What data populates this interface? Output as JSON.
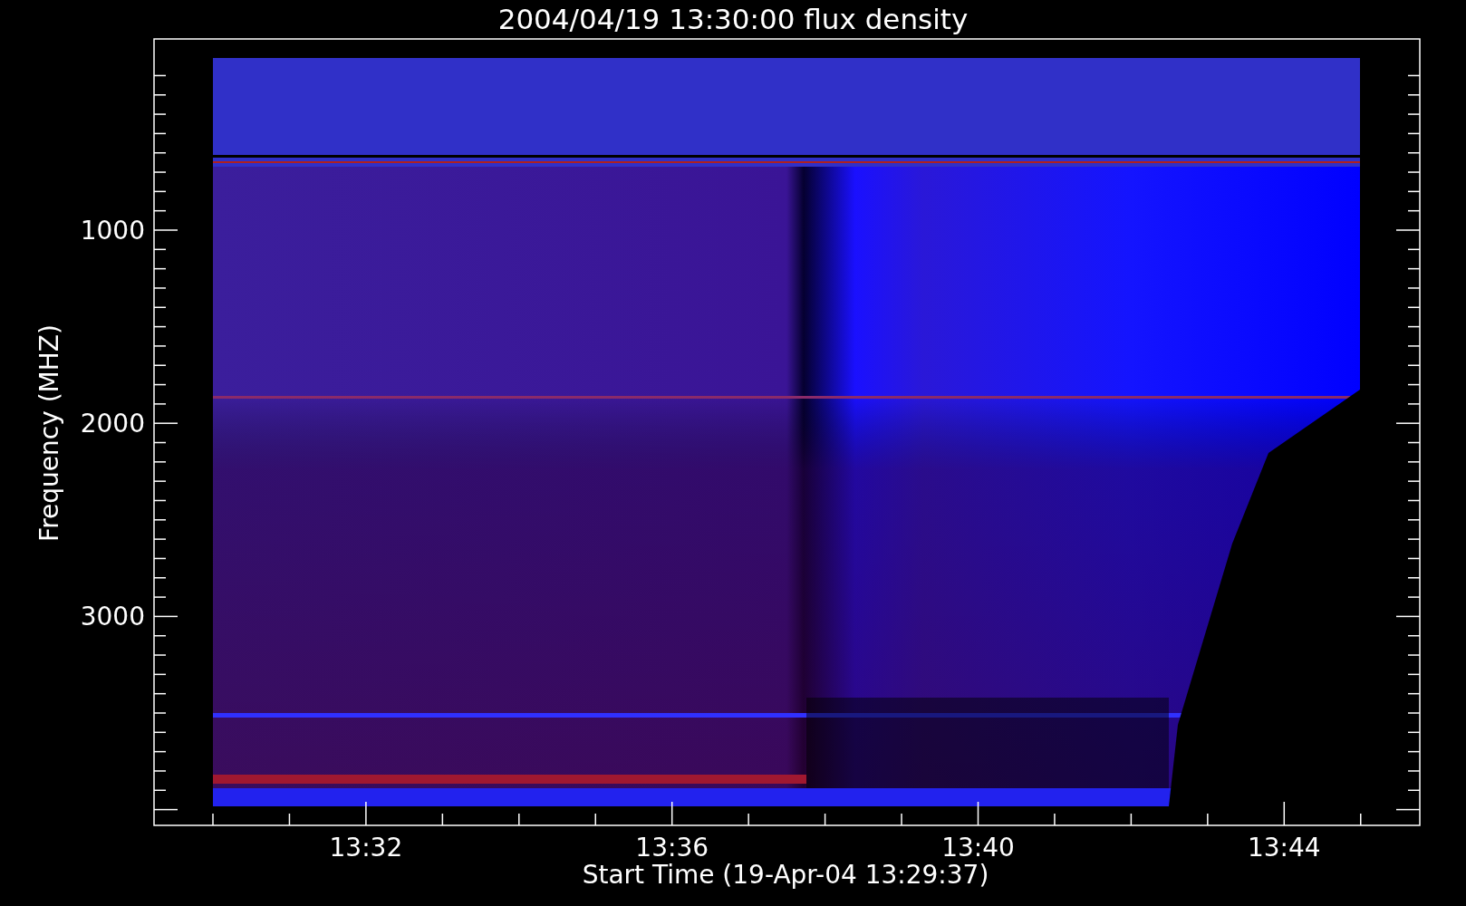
{
  "plot": {
    "title": "2004/04/19 13:30:00 flux density",
    "y_axis": {
      "label": "Frequency (MHZ)",
      "tick_labels": [
        "1000",
        "2000",
        "3000"
      ]
    },
    "x_axis": {
      "label": "Start Time (19-Apr-04 13:29:37)",
      "tick_labels": [
        "13:32",
        "13:36",
        "13:40",
        "13:44"
      ]
    }
  }
}
